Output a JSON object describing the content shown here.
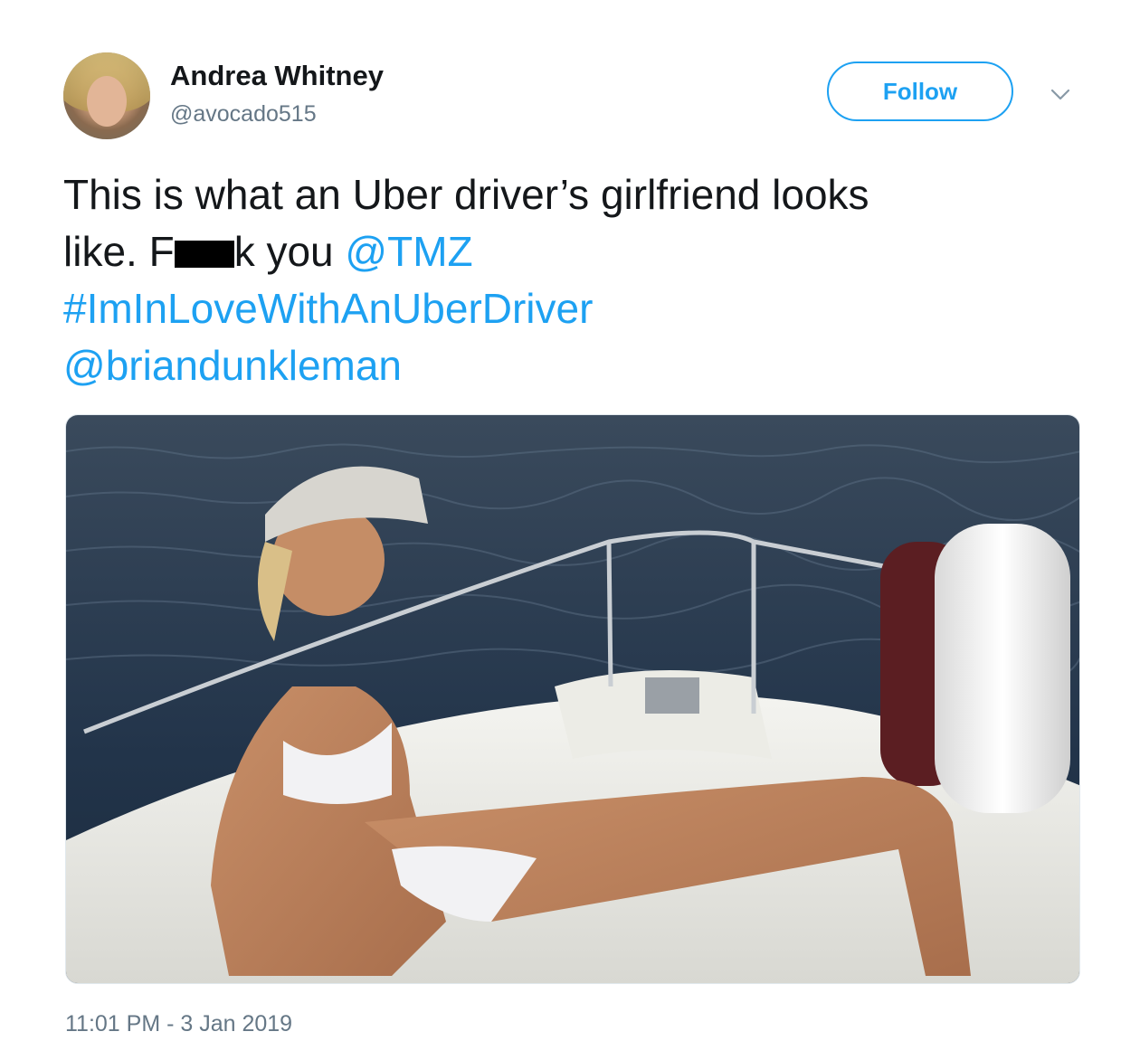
{
  "user": {
    "display_name": "Andrea Whitney",
    "handle": "@avocado515"
  },
  "actions": {
    "follow_label": "Follow",
    "menu_icon": "chevron-down-icon"
  },
  "tweet": {
    "line1": "This is what an Uber driver’s girlfriend looks",
    "line2_pre": "like. F",
    "line2_post": "k you ",
    "mention_tmz": "@TMZ",
    "hashtag": "#ImInLoveWithAnUberDriver",
    "mention_brian": "@briandunkleman"
  },
  "timestamp": "11:01 PM - 3 Jan 2019",
  "colors": {
    "link": "#1da1f2",
    "text": "#14171a",
    "muted": "#657786"
  }
}
